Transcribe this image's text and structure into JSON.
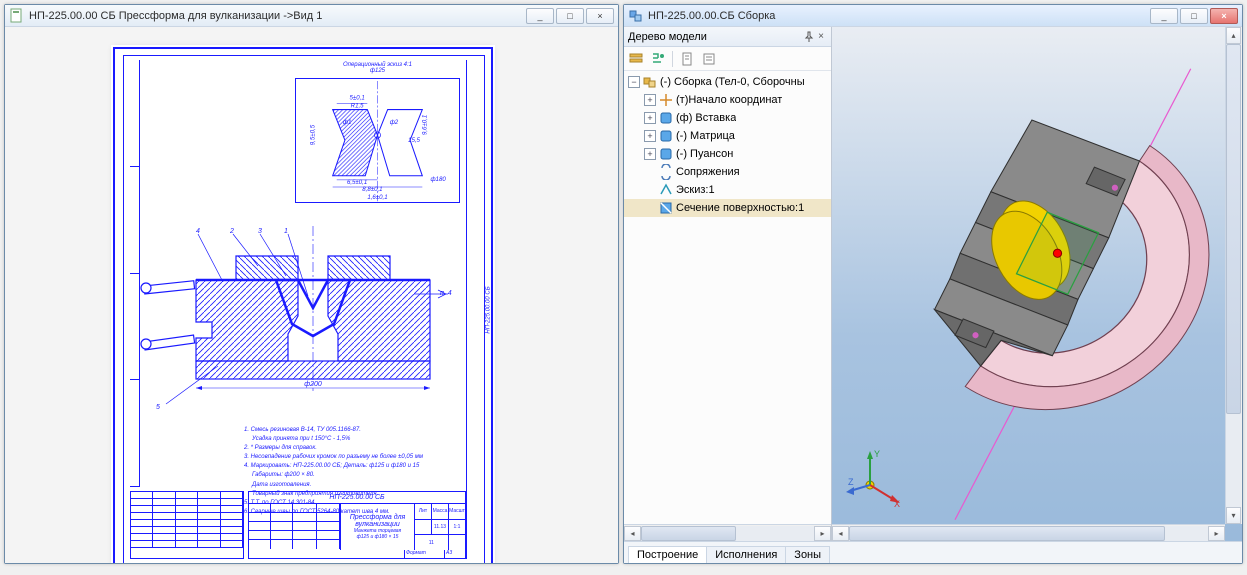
{
  "windows": {
    "left": {
      "title": "НП-225.00.00 СБ Прессформа для вулканизации ->Вид 1",
      "minimize": "_",
      "maximize": "□",
      "close": "×"
    },
    "right": {
      "title": "НП-225.00.00.СБ Сборка",
      "minimize": "_",
      "maximize": "□",
      "close": "×"
    }
  },
  "drawing": {
    "detail_title": "Операционный эскиз 4:1",
    "detail_dim_top": "ф125",
    "detail_dims": {
      "d1": "5±0,1",
      "d2": "R1,5",
      "d3": "ф1",
      "d4": "15,5",
      "d5": "9,5±0,5",
      "d6": "6,5±0,1",
      "d7": "8,8±0,1",
      "d8": "1,6±0,1",
      "d9": "ф180",
      "d10": "9,6±0,1",
      "d11": "ф2"
    },
    "side_code": "НП-225.00.00 СБ",
    "callouts": {
      "c1": "1",
      "c2": "2",
      "c3": "3",
      "c4": "4",
      "c5": "5",
      "cp4": "п. 4"
    },
    "sect_dim": "ф200",
    "notes": [
      "1. Смесь резиновая В-14, ТУ 005.1166-87.",
      "Усадка принята при t 150°С - 1,5%",
      "2. * Размеры для справок.",
      "3. Несовпадение рабочих кромок по разъему не более ±0,05 мм",
      "4. Маркировать: НП-225.00.00 СБ; Деталь: ф125 и ф180 и 15",
      "Габариты: ф200 × 80.",
      "Дата изготовления.",
      "Товарный знак предприятия изготовителя.",
      "5. Т.Т. по ГОСТ 14.301-84.",
      "6. Сварные швы по ГОСТ 5264-80 катет шва 4 мм."
    ],
    "titleblock": {
      "top_code": "НП-225.00.00 СБ",
      "name_line1": "Прессформа для",
      "name_line2": "вулканизации",
      "name_line3": "Манжета торцевая",
      "name_line4": "ф125 и ф180 × 15",
      "scale": "1:1",
      "mass": "11.13",
      "sheet": "11",
      "format": "Формат",
      "format_v": "А3",
      "lit": "Лит",
      "massa": "Масса",
      "mas": "Масшт"
    }
  },
  "tree": {
    "panel_title": "Дерево модели",
    "root": "(-) Сборка (Тел-0, Сборочны",
    "items": [
      {
        "label": "(т)Начало координат",
        "icon": "origin"
      },
      {
        "label": "(ф) Вставка",
        "icon": "part"
      },
      {
        "label": "(-) Матрица",
        "icon": "part"
      },
      {
        "label": "(-) Пуансон",
        "icon": "part"
      },
      {
        "label": "Сопряжения",
        "icon": "mates"
      },
      {
        "label": "Эскиз:1",
        "icon": "sketch"
      },
      {
        "label": "Сечение поверхностью:1",
        "icon": "section",
        "selected": true
      }
    ],
    "tabs": {
      "build": "Построение",
      "exec": "Исполнения",
      "zones": "Зоны"
    }
  },
  "axes": {
    "x": "X",
    "y": "Y",
    "z": "Z"
  }
}
